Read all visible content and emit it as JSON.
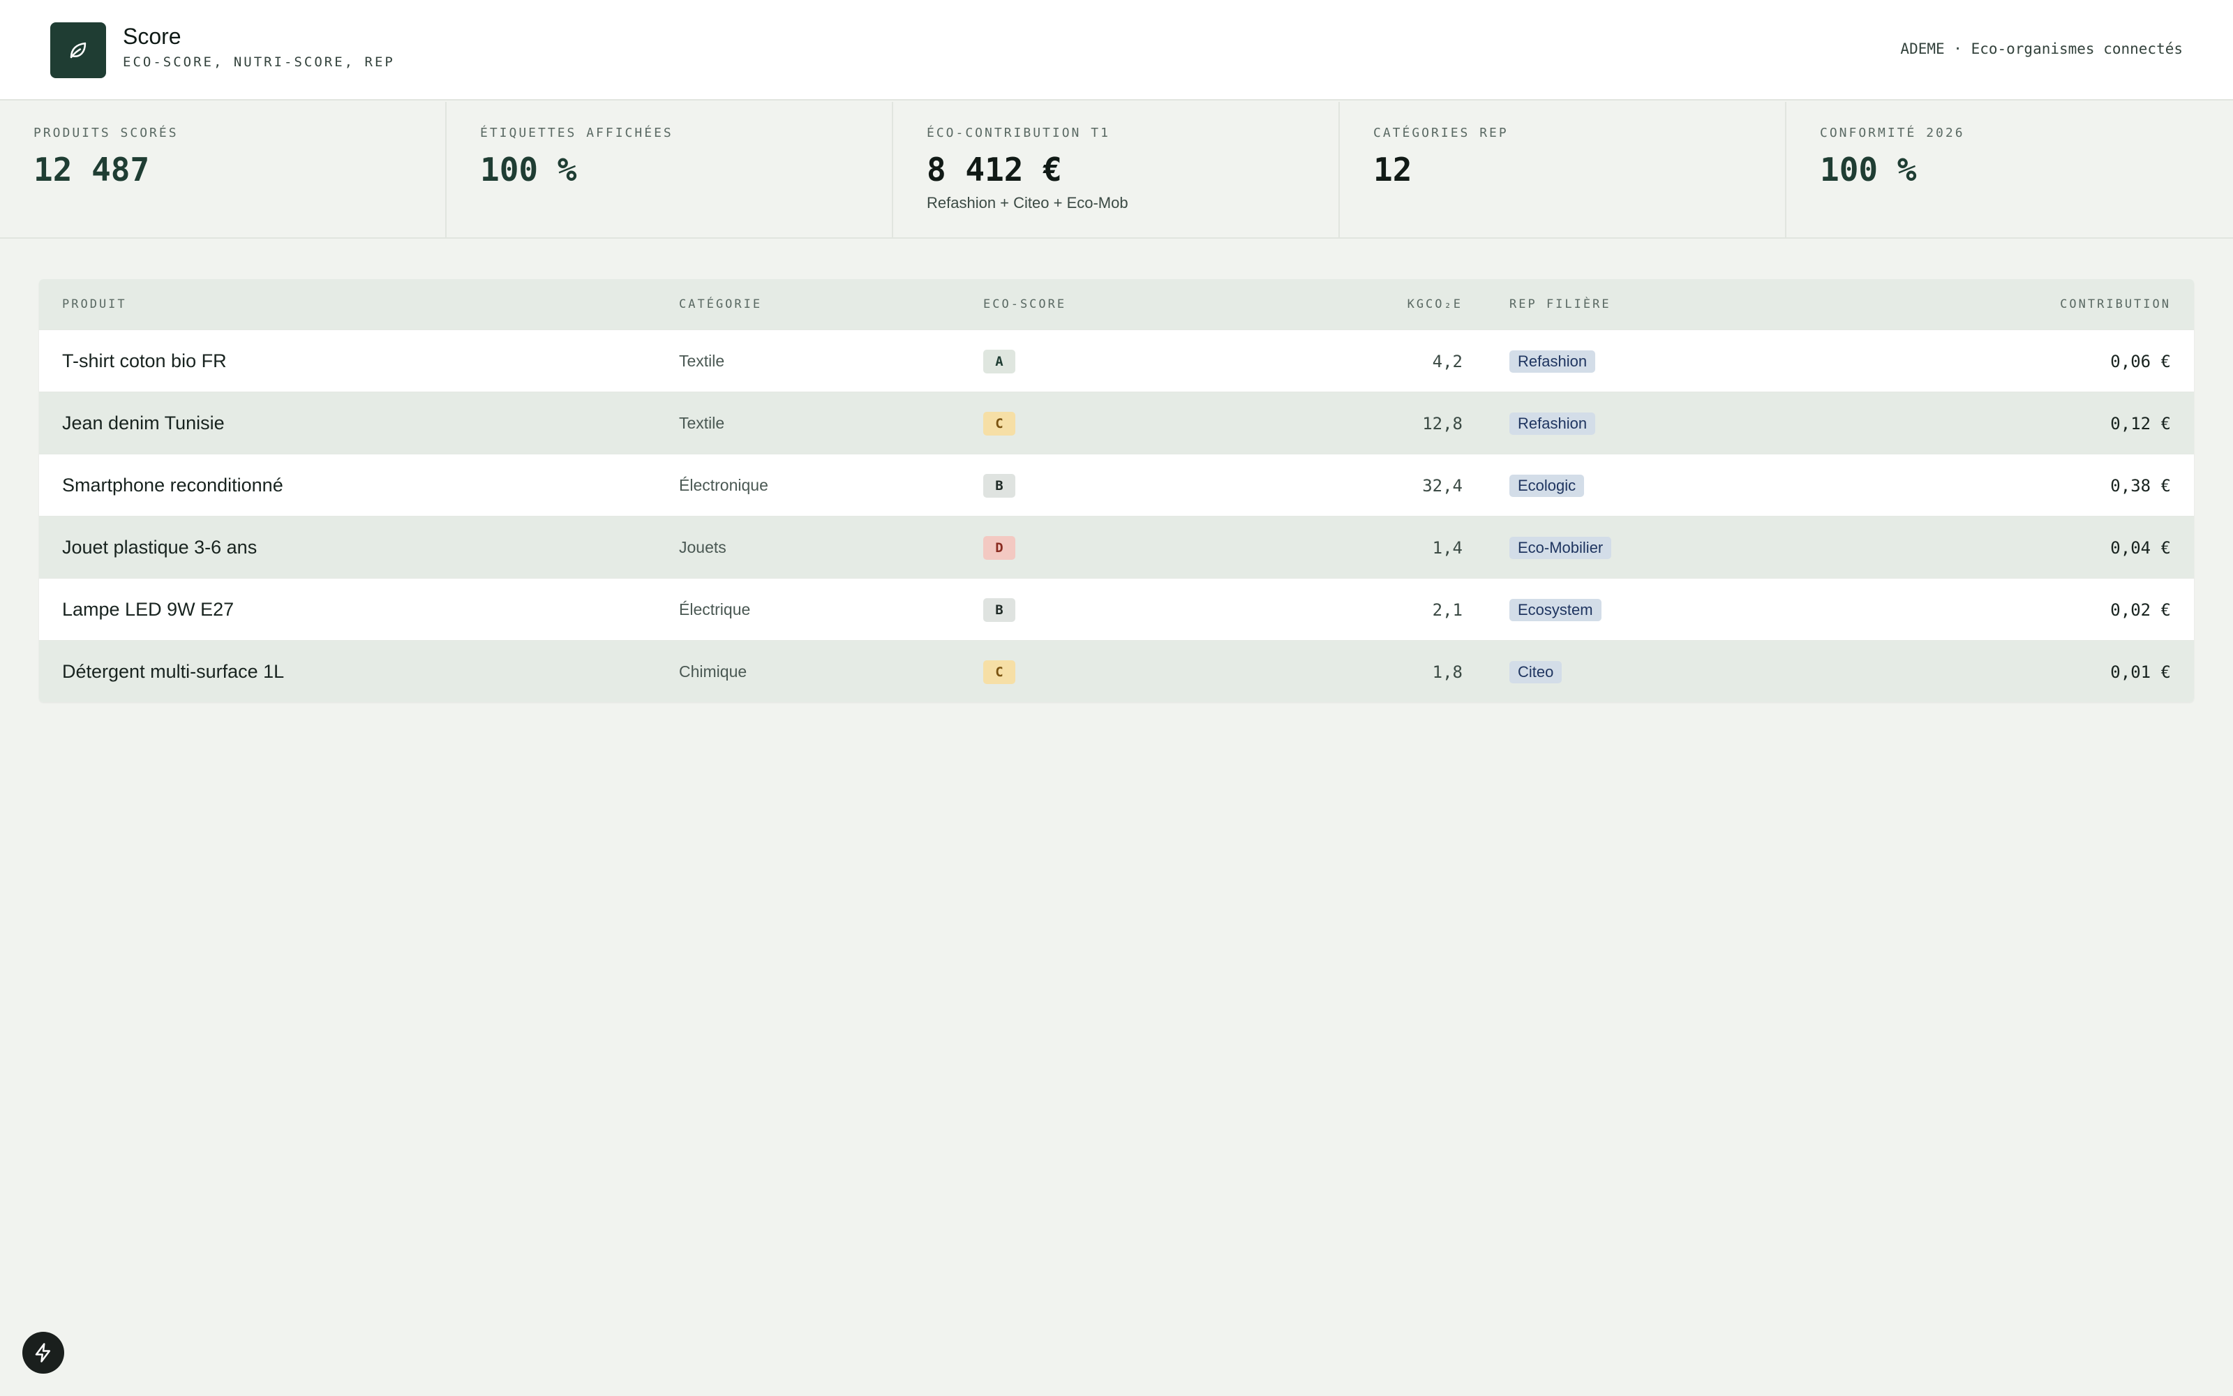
{
  "header": {
    "title": "Score",
    "subtitle": "ECO-SCORE, NUTRI-SCORE, REP",
    "right_text": "ADEME · Eco-organismes connectés",
    "logo_icon": "leaf-icon"
  },
  "stats": [
    {
      "label": "Produits scorés",
      "value": "12 487",
      "note": ""
    },
    {
      "label": "Étiquettes affichées",
      "value": "100 %",
      "note": ""
    },
    {
      "label": "Éco-contribution T1",
      "value": "8 412 €",
      "note": "Refashion + Citeo + Eco-Mob"
    },
    {
      "label": "Catégories REP",
      "value": "12",
      "note": ""
    },
    {
      "label": "Conformité 2026",
      "value": "100 %",
      "note": ""
    }
  ],
  "table": {
    "headers": {
      "product": "Produit",
      "category": "Catégorie",
      "score": "Eco-score",
      "co2": "KGCO₂E",
      "rep": "REP filière",
      "contribution": "Contribution"
    },
    "rows": [
      {
        "product": "T-shirt coton bio FR",
        "category": "Textile",
        "score": "A",
        "co2": "4,2",
        "rep": "Refashion",
        "contribution": "0,06 €"
      },
      {
        "product": "Jean denim Tunisie",
        "category": "Textile",
        "score": "C",
        "co2": "12,8",
        "rep": "Refashion",
        "contribution": "0,12 €"
      },
      {
        "product": "Smartphone reconditionné",
        "category": "Électronique",
        "score": "B",
        "co2": "32,4",
        "rep": "Ecologic",
        "contribution": "0,38 €"
      },
      {
        "product": "Jouet plastique 3-6 ans",
        "category": "Jouets",
        "score": "D",
        "co2": "1,4",
        "rep": "Eco-Mobilier",
        "contribution": "0,04 €"
      },
      {
        "product": "Lampe LED 9W E27",
        "category": "Électrique",
        "score": "B",
        "co2": "2,1",
        "rep": "Ecosystem",
        "contribution": "0,02 €"
      },
      {
        "product": "Détergent multi-surface 1L",
        "category": "Chimique",
        "score": "C",
        "co2": "1,8",
        "rep": "Citeo",
        "contribution": "0,01 €"
      }
    ]
  },
  "score_colors": {
    "A": {
      "bg": "#dfe6df",
      "fg": "#1f3d33"
    },
    "B": {
      "bg": "#dfe3e0",
      "fg": "#1f2a26"
    },
    "C": {
      "bg": "#f6dfa6",
      "fg": "#7a5310"
    },
    "D": {
      "bg": "#f3c9c2",
      "fg": "#8a2b20"
    }
  },
  "fab_icon": "lightning-icon"
}
